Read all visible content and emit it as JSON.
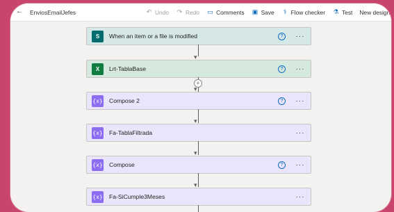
{
  "toolbar": {
    "flow_name": "EnviosEmailJefes",
    "undo": "Undo",
    "redo": "Redo",
    "comments": "Comments",
    "save": "Save",
    "flow_checker": "Flow checker",
    "test": "Test",
    "new_designer": "New designer"
  },
  "cards": [
    {
      "title": "When an item or a file is modified",
      "icon": "sharepoint-icon",
      "has_help": true
    },
    {
      "title": "Lrt-TablaBase",
      "icon": "excel-icon",
      "has_help": true
    },
    {
      "title": "Compose 2",
      "icon": "compose-icon",
      "has_help": true
    },
    {
      "title": "Fa-TablaFiltrada",
      "icon": "compose-icon",
      "has_help": false
    },
    {
      "title": "Compose",
      "icon": "compose-icon",
      "has_help": true
    },
    {
      "title": "Fa-SiCumple3Meses",
      "icon": "compose-icon",
      "has_help": false
    }
  ],
  "glyphs": {
    "help": "?",
    "more": "···",
    "plus": "+",
    "arrow": "▾",
    "sp_letter": "S",
    "xl_letter": "X",
    "compose": "{x}"
  },
  "colors": {
    "page_background": "#c8466e",
    "accent": "#0f6cbd",
    "trigger_card": "#d5e7e7",
    "excel_card": "#d6e9de",
    "compose_card": "#ebe5fb",
    "compose_icon": "#8c6cf0"
  }
}
